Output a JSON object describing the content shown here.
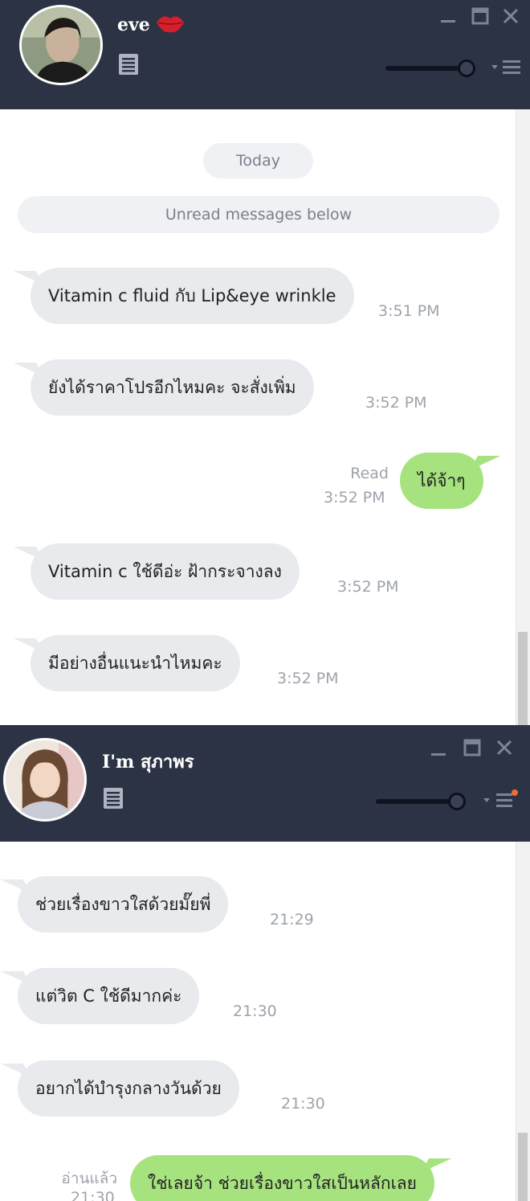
{
  "window1": {
    "contact_name": "eve",
    "contact_badge_icon": "kiss-lips-icon",
    "date_separator": "Today",
    "unread_divider": "Unread messages below",
    "messages": [
      {
        "dir": "in",
        "text": "Vitamin c fluid กับ Lip&eye wrinkle",
        "time": "3:51 PM"
      },
      {
        "dir": "in",
        "text": "ยังได้ราคาโปรอีกไหมคะ จะสั่งเพิ่ม",
        "time": "3:52 PM"
      },
      {
        "dir": "out",
        "text": "ได้จ้าๆ",
        "status": "Read",
        "time": "3:52 PM"
      },
      {
        "dir": "in",
        "text": "Vitamin c ใช้ดีอ่ะ ฝ้ากระจางลง",
        "time": "3:52 PM"
      },
      {
        "dir": "in",
        "text": "มีอย่างอื่นแนะนำไหมคะ",
        "time": "3:52 PM"
      }
    ]
  },
  "window2": {
    "contact_name": "I'm สุภาพร",
    "messages": [
      {
        "dir": "in",
        "text": "ช่วยเรื่องขาวใสด้วยมั๊ยพี่",
        "time": "21:29"
      },
      {
        "dir": "in",
        "text": "แต่วิต C ใช้ดีมากค่ะ",
        "time": "21:30"
      },
      {
        "dir": "in",
        "text": "อยากได้บำรุงกลางวันด้วย",
        "time": "21:30"
      },
      {
        "dir": "out",
        "text": "ใช่เลยจ้า ช่วยเรื่องขาวใสเป็นหลักเลย",
        "status": "อ่านแล้ว",
        "time": "21:30"
      }
    ]
  },
  "colors": {
    "header_bg": "#2c3344",
    "incoming_bubble": "#e8eaee",
    "outgoing_bubble": "#a6e27e",
    "timestamp_text": "#9ea3ab",
    "notify_dot": "#f26a2e"
  },
  "icons": [
    "note-icon",
    "minimize-icon",
    "maximize-icon",
    "close-icon",
    "volume-slider",
    "menu-icon",
    "kiss-lips-icon"
  ]
}
